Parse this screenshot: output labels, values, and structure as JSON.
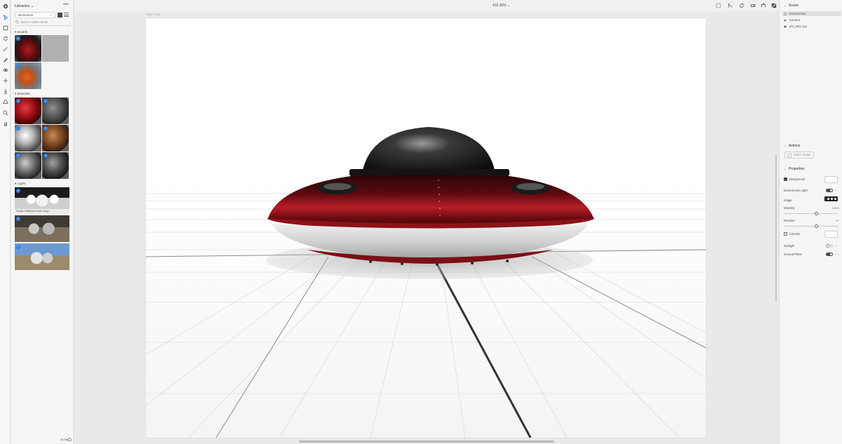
{
  "toolrail": {
    "tools": [
      "home-icon",
      "select-icon",
      "marquee-icon",
      "orbit-icon",
      "magic-wand-icon",
      "sampler-icon",
      "rotate-icon",
      "move-icon",
      "drop-to-ground-icon",
      "perspective-icon",
      "zoom-icon",
      "hand-icon"
    ],
    "active_tool": "select-icon"
  },
  "libraries": {
    "title": "Libraries",
    "library_name": "Dimension",
    "search_placeholder": "Search Adobe Stock",
    "sections": {
      "models": "Models",
      "materials": "Materials",
      "lights": "Lights"
    },
    "lights": [
      {
        "caption": "Studio Softboxes and Lamp"
      }
    ],
    "footer_size": "13 KB"
  },
  "topbar": {
    "zoom": "415.36%"
  },
  "canvas": {
    "size_label": "1024 x 768"
  },
  "scene": {
    "title": "Scene",
    "items": [
      {
        "label": "Environment",
        "icon": "environment-icon",
        "selected": true
      },
      {
        "label": "Camera",
        "icon": "camera-icon",
        "selected": false
      },
      {
        "label": "ufo_retro_toy",
        "icon": "model-icon",
        "selected": false
      }
    ]
  },
  "actions": {
    "title": "Actions",
    "match_image": "Match Image"
  },
  "properties": {
    "title": "Properties",
    "background_label": "Background",
    "environment_light_label": "Environment Light",
    "image_label": "Image",
    "intensity_label": "Intensity",
    "intensity_value": "100%",
    "intensity_level": 0.6,
    "rotation_label": "Rotation",
    "rotation_value": "0°",
    "rotation_level": 0.6,
    "colorize_label": "Colorize",
    "sunlight_label": "Sunlight",
    "ground_plane_label": "Ground Plane"
  },
  "colors": {
    "accent": "#2680eb",
    "ufo_red": "#8b1219",
    "panel_bg": "#f5f5f5"
  }
}
